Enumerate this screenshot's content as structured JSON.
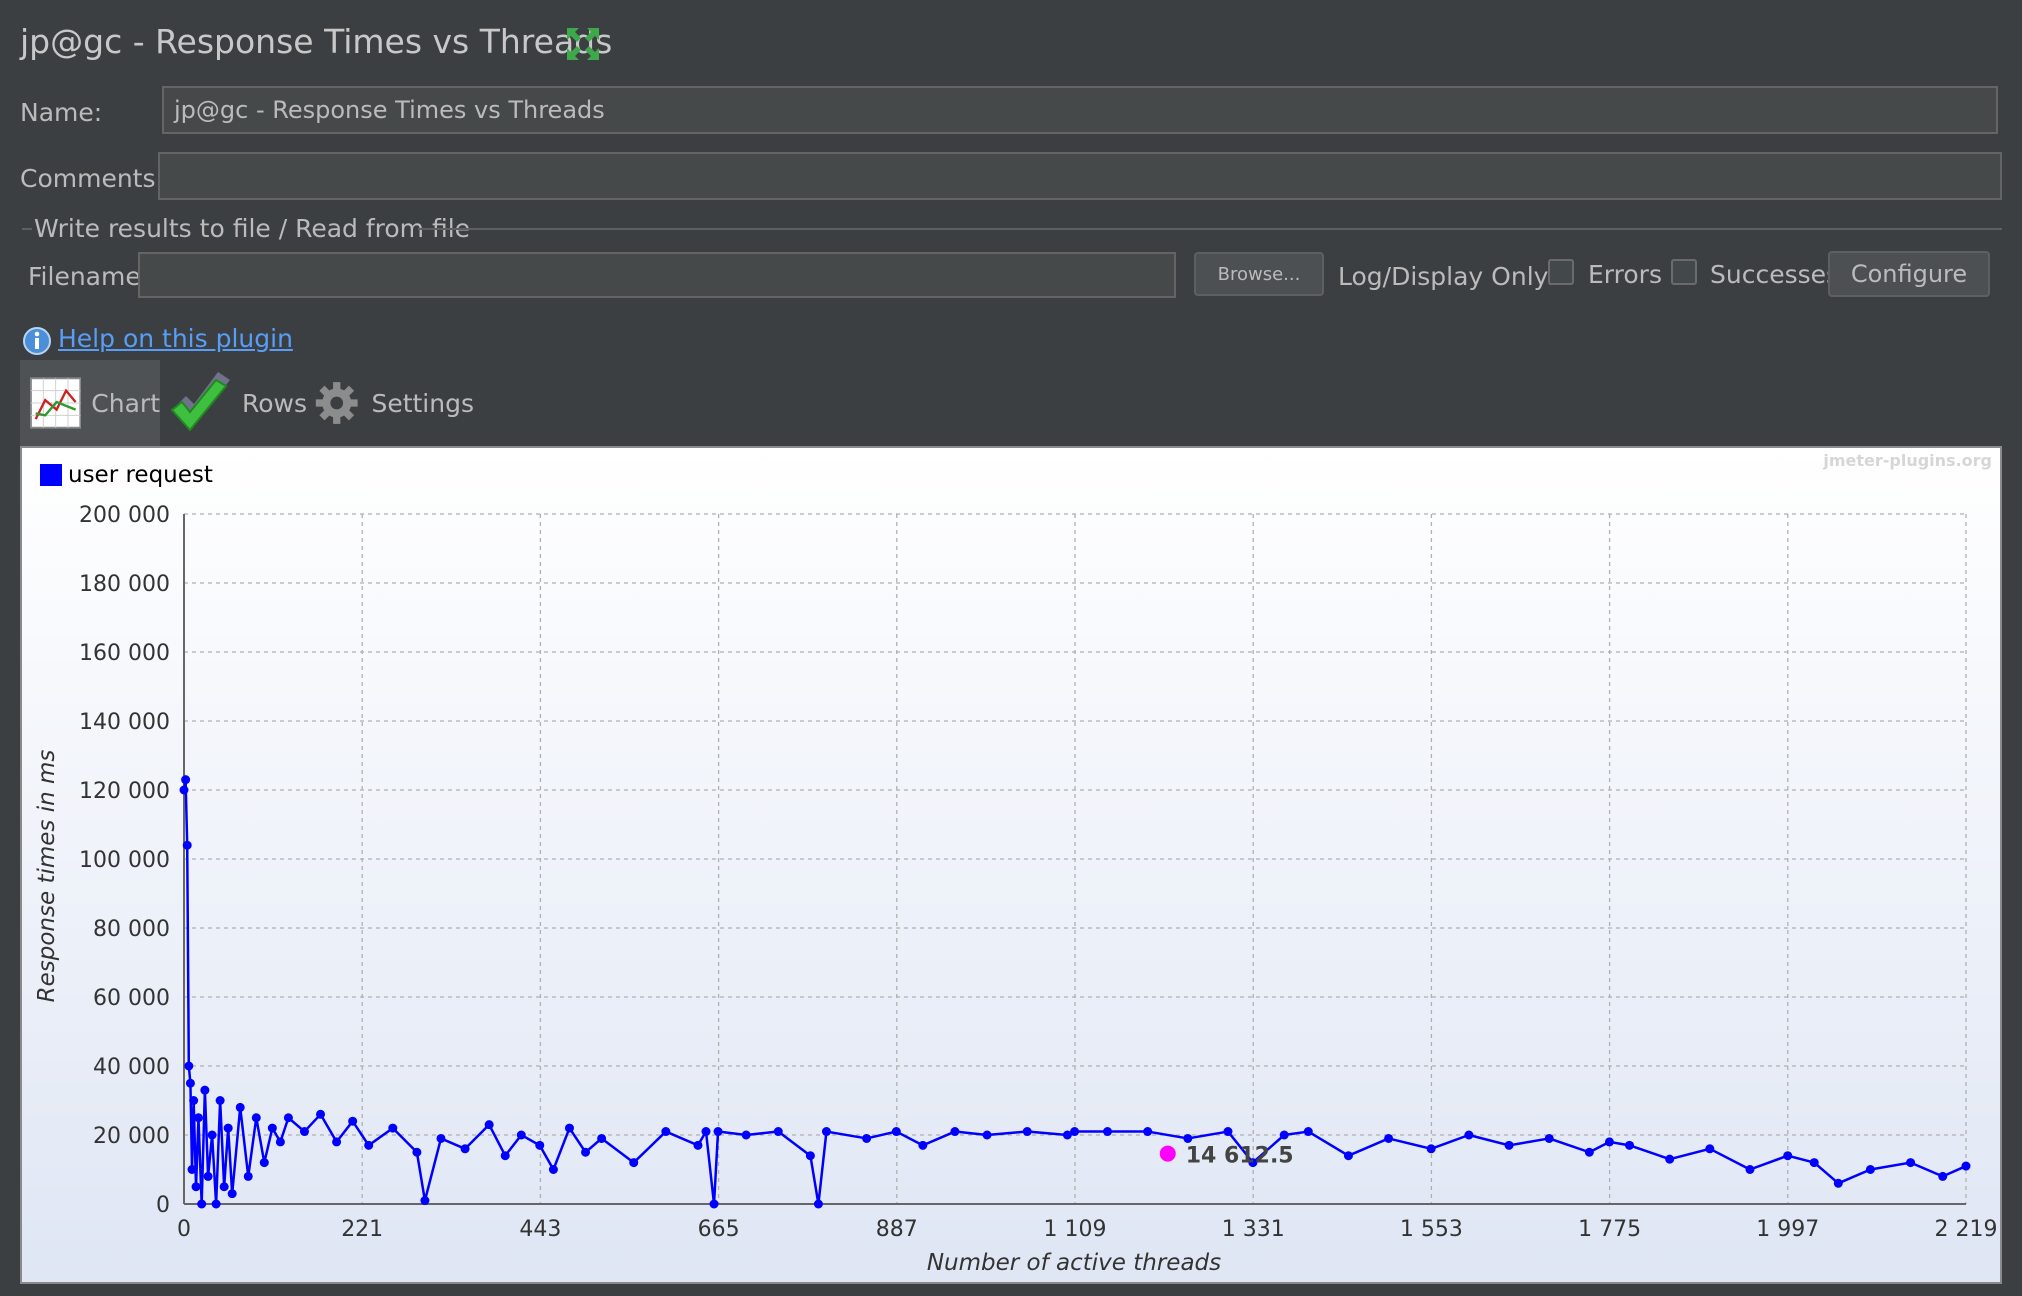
{
  "panel": {
    "title": "jp@gc - Response Times vs Threads"
  },
  "form": {
    "name_label": "Name:",
    "name_value": "jp@gc - Response Times vs Threads",
    "comments_label": "Comments:",
    "comments_value": ""
  },
  "file_group": {
    "legend": "Write results to file / Read from file",
    "filename_label": "Filename",
    "filename_value": "",
    "browse_label": "Browse...",
    "log_display_label": "Log/Display Only:",
    "errors_label": "Errors",
    "successes_label": "Successes",
    "configure_label": "Configure"
  },
  "help": {
    "link_text": "Help on this plugin"
  },
  "tabs": [
    {
      "label": "Chart",
      "icon": "chart-icon",
      "active": true
    },
    {
      "label": "Rows",
      "icon": "checkmark-icon",
      "active": false
    },
    {
      "label": "Settings",
      "icon": "gear-icon",
      "active": false
    }
  ],
  "colors": {
    "series": "#0000ff",
    "tooltip_dot": "#ff00ff",
    "background": "#3c3f41"
  },
  "chart_data": {
    "type": "line",
    "watermark": "jmeter-plugins.org",
    "xlabel": "Number of active threads",
    "ylabel": "Response times in ms",
    "xlim": [
      0,
      2219
    ],
    "ylim": [
      0,
      200000
    ],
    "x_ticks": [
      "0",
      "221",
      "443",
      "665",
      "887",
      "1 109",
      "1 331",
      "1 553",
      "1 775",
      "1 997",
      "2 219"
    ],
    "y_ticks": [
      "0",
      "20 000",
      "40 000",
      "60 000",
      "80 000",
      "100 000",
      "120 000",
      "140 000",
      "160 000",
      "180 000",
      "200 000"
    ],
    "grid": true,
    "legend_position": "top-left",
    "hover_point": {
      "x": 1225,
      "y": 14612,
      "label": "14 612.5"
    },
    "series": [
      {
        "name": "user request",
        "x": [
          0,
          2,
          4,
          6,
          8,
          10,
          12,
          15,
          18,
          22,
          26,
          30,
          35,
          40,
          45,
          50,
          55,
          60,
          70,
          80,
          90,
          100,
          110,
          120,
          130,
          150,
          170,
          190,
          210,
          230,
          260,
          290,
          300,
          320,
          350,
          380,
          400,
          420,
          443,
          460,
          480,
          500,
          520,
          560,
          600,
          640,
          650,
          660,
          665,
          700,
          740,
          780,
          790,
          800,
          850,
          887,
          920,
          960,
          1000,
          1050,
          1100,
          1109,
          1150,
          1200,
          1250,
          1300,
          1331,
          1370,
          1400,
          1450,
          1500,
          1553,
          1600,
          1650,
          1700,
          1750,
          1775,
          1800,
          1850,
          1900,
          1950,
          1997,
          2030,
          2060,
          2100,
          2150,
          2190,
          2219
        ],
        "y": [
          120000,
          123000,
          104000,
          40000,
          35000,
          10000,
          30000,
          5000,
          25000,
          0,
          33000,
          8000,
          20000,
          0,
          30000,
          5000,
          22000,
          3000,
          28000,
          8000,
          25000,
          12000,
          22000,
          18000,
          25000,
          21000,
          26000,
          18000,
          24000,
          17000,
          22000,
          15000,
          1000,
          19000,
          16000,
          23000,
          14000,
          20000,
          17000,
          10000,
          22000,
          15000,
          19000,
          12000,
          21000,
          17000,
          21000,
          0,
          21000,
          20000,
          21000,
          14000,
          0,
          21000,
          19000,
          21000,
          17000,
          21000,
          20000,
          21000,
          20000,
          21000,
          21000,
          21000,
          19000,
          21000,
          12000,
          20000,
          21000,
          14000,
          19000,
          16000,
          20000,
          17000,
          19000,
          15000,
          18000,
          17000,
          13000,
          16000,
          10000,
          14000,
          12000,
          6000,
          10000,
          12000,
          8000,
          11000
        ]
      }
    ]
  }
}
